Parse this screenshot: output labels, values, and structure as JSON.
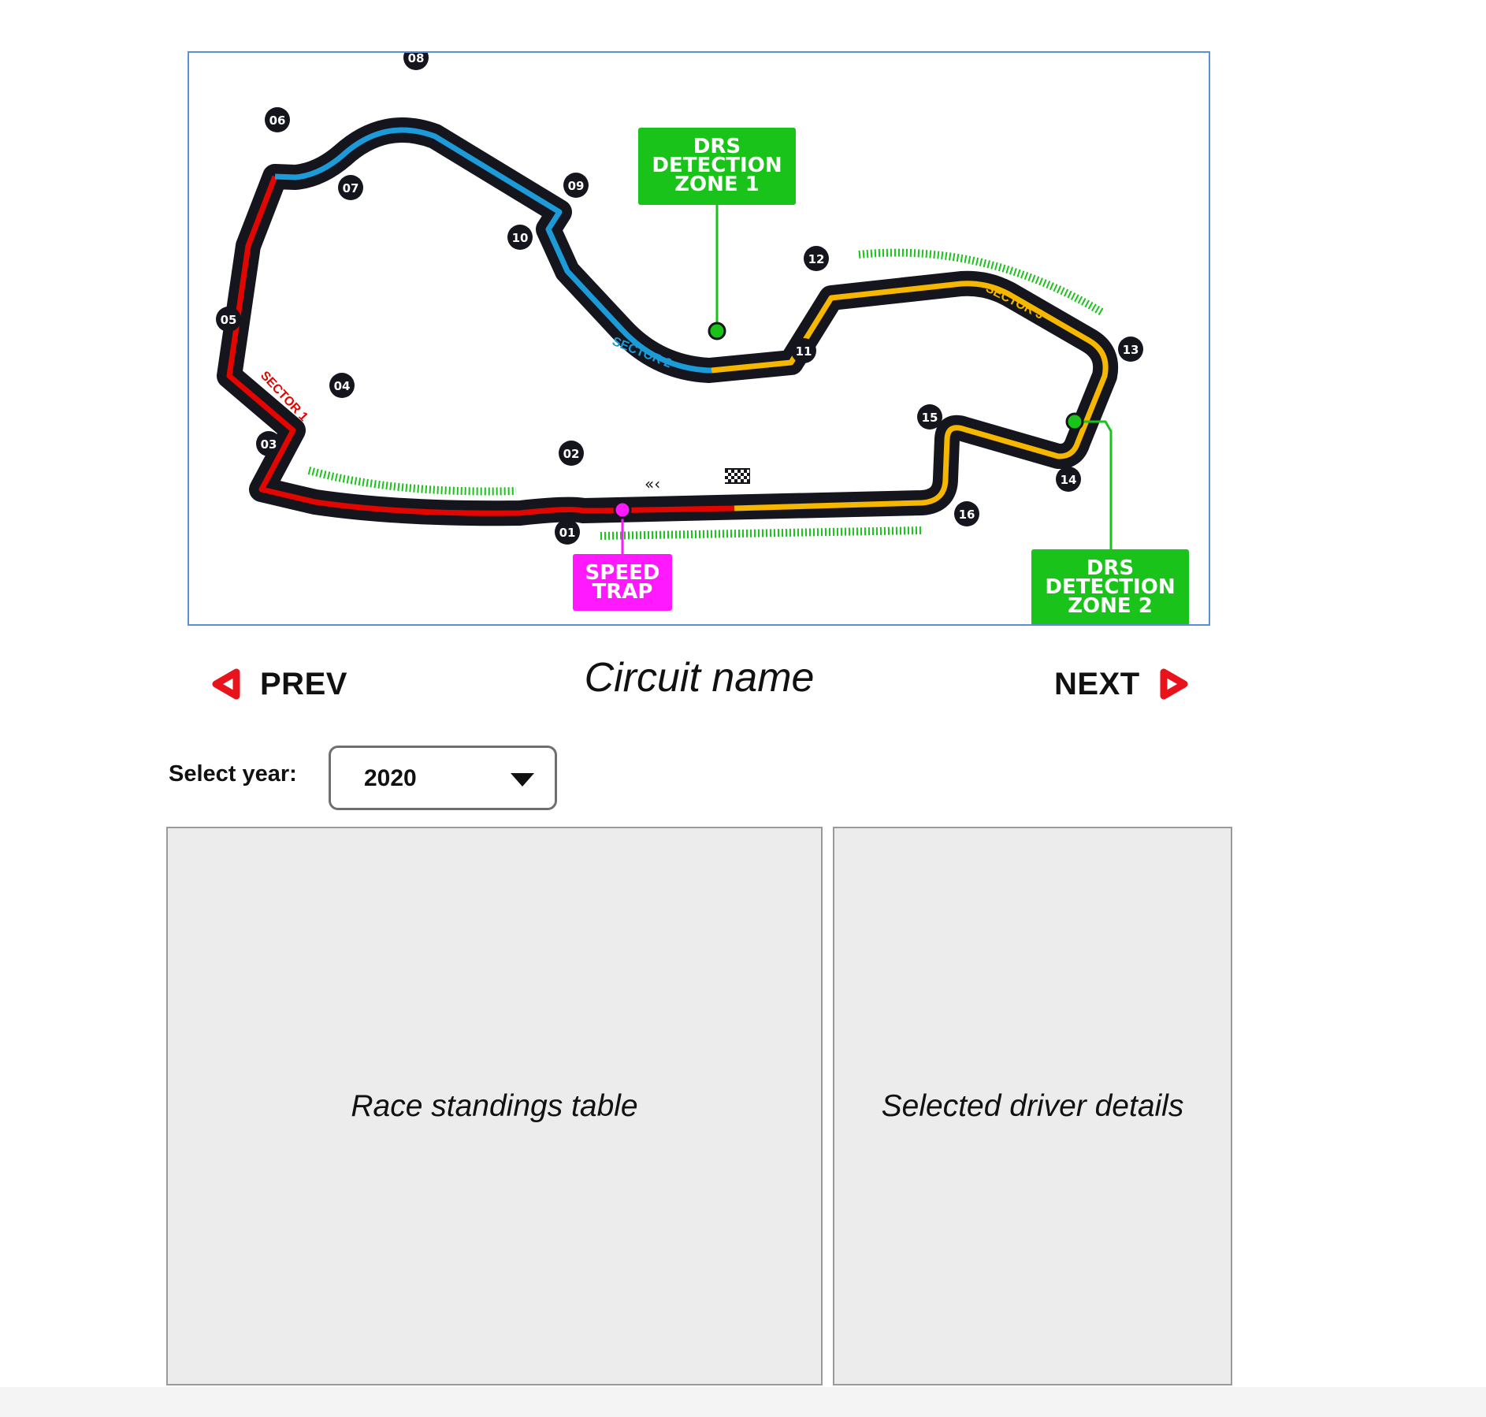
{
  "circuit_map": {
    "turns": [
      "01",
      "02",
      "03",
      "04",
      "05",
      "06",
      "07",
      "08",
      "09",
      "10",
      "11",
      "12",
      "13",
      "14",
      "15",
      "16"
    ],
    "sector_labels": [
      "SECTOR 1",
      "SECTOR 2",
      "SECTOR 3"
    ],
    "drs_zone_1": [
      "DRS",
      "DETECTION",
      "ZONE 1"
    ],
    "drs_zone_2": [
      "DRS",
      "DETECTION",
      "ZONE 2"
    ],
    "speed_trap": [
      "SPEED",
      "TRAP"
    ],
    "colors": {
      "track": "#15151e",
      "sector1": "#e10600",
      "sector2": "#1d9bd8",
      "sector3": "#f5b700",
      "drs": "#19c319",
      "speed_trap": "#ff19ff"
    }
  },
  "nav": {
    "prev_label": "PREV",
    "next_label": "NEXT",
    "arrow_color": "#e8131b"
  },
  "circuit_name": "Circuit name",
  "year_selector": {
    "label": "Select year:",
    "selected": "2020"
  },
  "panels": {
    "standings": "Race standings table",
    "driver": "Selected driver details"
  }
}
